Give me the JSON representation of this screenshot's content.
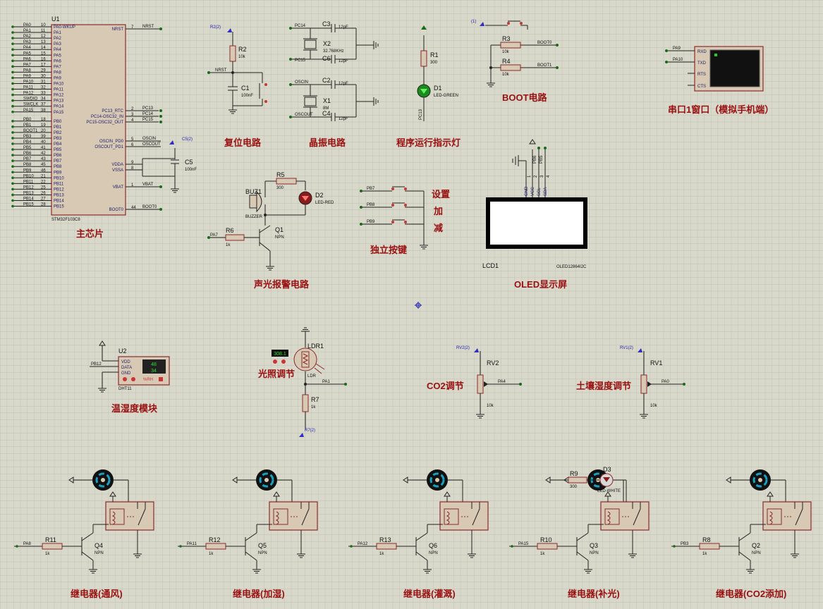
{
  "sections": {
    "main_chip": "主芯片",
    "reset": "复位电路",
    "crystal": "晶振电路",
    "run_led": "程序运行指示灯",
    "boot": "BOOT电路",
    "uart": "串口1窗口（模拟手机端）",
    "alarm": "声光报警电路",
    "keys": "独立按键",
    "oled": "OLED显示屏",
    "temp": "温湿度模块",
    "light": "光照调节",
    "co2": "CO2调节",
    "soil": "土壤湿度调节",
    "relay_fan": "继电器(通风)",
    "relay_humid": "继电器(加湿)",
    "relay_water": "继电器(灌溉)",
    "relay_light": "继电器(补光)",
    "relay_co2": "继电器(CO2添加)"
  },
  "keys": {
    "set": "设置",
    "add": "加",
    "sub": "减"
  },
  "mcu": {
    "ref": "U1",
    "part": "STM32F103C8",
    "left_pins": [
      {
        "name": "PA0-WKUP",
        "num": "10"
      },
      {
        "name": "PA1",
        "num": "11"
      },
      {
        "name": "PA2",
        "num": "12"
      },
      {
        "name": "PA3",
        "num": "13"
      },
      {
        "name": "PA4",
        "num": "14"
      },
      {
        "name": "PA5",
        "num": "15"
      },
      {
        "name": "PA6",
        "num": "16"
      },
      {
        "name": "PA7",
        "num": "17"
      },
      {
        "name": "PA8",
        "num": "29"
      },
      {
        "name": "PA9",
        "num": "30"
      },
      {
        "name": "PA10",
        "num": "31"
      },
      {
        "name": "PA11",
        "num": "32"
      },
      {
        "name": "PA12",
        "num": "33"
      },
      {
        "name": "PA13",
        "num": "34"
      },
      {
        "name": "PA14",
        "num": "37"
      },
      {
        "name": "PA15",
        "num": "38"
      },
      {
        "name": "PB0",
        "num": "18"
      },
      {
        "name": "PB1",
        "num": "19"
      },
      {
        "name": "PB2",
        "num": "20"
      },
      {
        "name": "PB3",
        "num": "39"
      },
      {
        "name": "PB4",
        "num": "40"
      },
      {
        "name": "PB5",
        "num": "41"
      },
      {
        "name": "PB6",
        "num": "42"
      },
      {
        "name": "PB7",
        "num": "43"
      },
      {
        "name": "PB8",
        "num": "45"
      },
      {
        "name": "PB9",
        "num": "46"
      },
      {
        "name": "PB10",
        "num": "21"
      },
      {
        "name": "PB11",
        "num": "22"
      },
      {
        "name": "PB12",
        "num": "25"
      },
      {
        "name": "PB13",
        "num": "26"
      },
      {
        "name": "PB14",
        "num": "27"
      },
      {
        "name": "PB15",
        "num": "28"
      }
    ],
    "left_nets": [
      "PA0",
      "PA1",
      "PA2",
      "PA3",
      "PA4",
      "PA5",
      "PA6",
      "PA7",
      "PA8",
      "PA9",
      "PA10",
      "PA11",
      "PA12",
      "SWDIO",
      "SWCLK",
      "PA15",
      "PB0",
      "PB1",
      "BOOT1",
      "PB3",
      "PB4",
      "PB5",
      "PB6",
      "PB7",
      "PB8",
      "PB9",
      "PB10",
      "PB11",
      "PB12",
      "PB13",
      "PB14",
      "PB15"
    ],
    "right_pins": {
      "nrst": "NRST",
      "nrst_num": "7",
      "pc13": "PC13_RTC",
      "pc13_num": "2",
      "pc14": "PC14-OSC32_IN",
      "pc14_num": "3",
      "pc15": "PC15-OSC32_OUT",
      "pc15_num": "4",
      "oscin": "OSCIN_PD0",
      "oscin_num": "5",
      "oscout": "OSCOUT_PD1",
      "oscout_num": "6",
      "vdda": "VDDA",
      "vdda_num": "9",
      "vssa": "VSSA",
      "vssa_num": "8",
      "vbat": "VBAT",
      "vbat_num": "1",
      "boot0": "BOOT0",
      "boot0_num": "44"
    },
    "right_nets": {
      "nrst": "NRST",
      "pc13": "PC13",
      "pc14": "PC14",
      "pc15": "PC15",
      "oscin": "OSCIN",
      "oscout": "OSCOUT",
      "vbat": "VBAT",
      "boot0": "BOOT0"
    }
  },
  "parts": {
    "r2": "R2",
    "r2v": "10k",
    "c1": "C1",
    "c1v": "100nF",
    "c5": "C5",
    "c5v": "100nF",
    "c5probe": "C5(2)",
    "r2probe": "R2(2)",
    "nrst": "NRST",
    "c3": "C3",
    "c6": "C6",
    "c2": "C2",
    "c4": "C4",
    "cap12": "12pF",
    "x2": "X2",
    "x2v": "32.768KHz",
    "x1": "X1",
    "x1v": "8M",
    "pc14": "PC14",
    "pc15": "PC15",
    "oscin": "OSCIN",
    "oscout": "OSCOUT",
    "r1": "R1",
    "r1v": "300",
    "d1": "D1",
    "d1v": "LED-GREEN",
    "pc13": "PC13",
    "r3": "R3",
    "r3v": "10k",
    "r4": "R4",
    "r4v": "10k",
    "boot0": "BOOT0",
    "boot1": "BOOT1",
    "probe1": "(1)",
    "rxd": "RXD",
    "txd": "TXD",
    "rts": "RTS",
    "cts": "CTS",
    "pa9": "PA9",
    "pa10": "PA10",
    "buz": "BUZ1",
    "buzv": "BUZZER",
    "r5": "R5",
    "r5v": "300",
    "d2": "D2",
    "d2v": "LED-RED",
    "r6": "R6",
    "r6v": "1k",
    "pa7": "PA7",
    "q1": "Q1",
    "npn": "NPN",
    "pb7": "PB7",
    "pb8": "PB8",
    "pb9": "PB9",
    "lcd": "LCD1",
    "lcdv": "OLED12864I2C",
    "lcdpins": [
      "GND",
      "VCC",
      "SCL",
      "SDA"
    ],
    "lcdnums": [
      "1",
      "2",
      "3",
      "4"
    ],
    "pb6": "PB6",
    "pb5": "PB5",
    "u2": "U2",
    "u2v": "DHT11",
    "vdd": "VDD",
    "data": "DATA",
    "gnd": "GND",
    "pb12": "PB12",
    "temp_val": "48",
    "hum_val": "34",
    "rh": "%RH",
    "ldr": "LDR1",
    "ldrv": "LDR",
    "ldr_val": "308.1",
    "r7": "R7",
    "r7v": "1k",
    "pa1": "PA1",
    "r7probe": "R7(2)",
    "rv2": "RV2",
    "rv2v": "10k",
    "pa4": "PA4",
    "rv2probe": "RV2(2)",
    "rv1": "RV1",
    "rv1v": "10k",
    "pa0": "PA0",
    "rv1probe": "RV1(2)",
    "r9": "R9",
    "r9v": "300",
    "d3": "D3",
    "d3v": "LED-WHITE"
  },
  "relays": [
    {
      "net": "PA8",
      "r": "R11",
      "q": "Q4",
      "rv": "1k"
    },
    {
      "net": "PA11",
      "r": "R12",
      "q": "Q5",
      "rv": "1k"
    },
    {
      "net": "PA12",
      "r": "R13",
      "q": "Q6",
      "rv": "1k"
    },
    {
      "net": "PA15",
      "r": "R10",
      "q": "Q3",
      "rv": "1k"
    },
    {
      "net": "PB3",
      "r": "R8",
      "q": "Q2",
      "rv": "1k"
    }
  ]
}
